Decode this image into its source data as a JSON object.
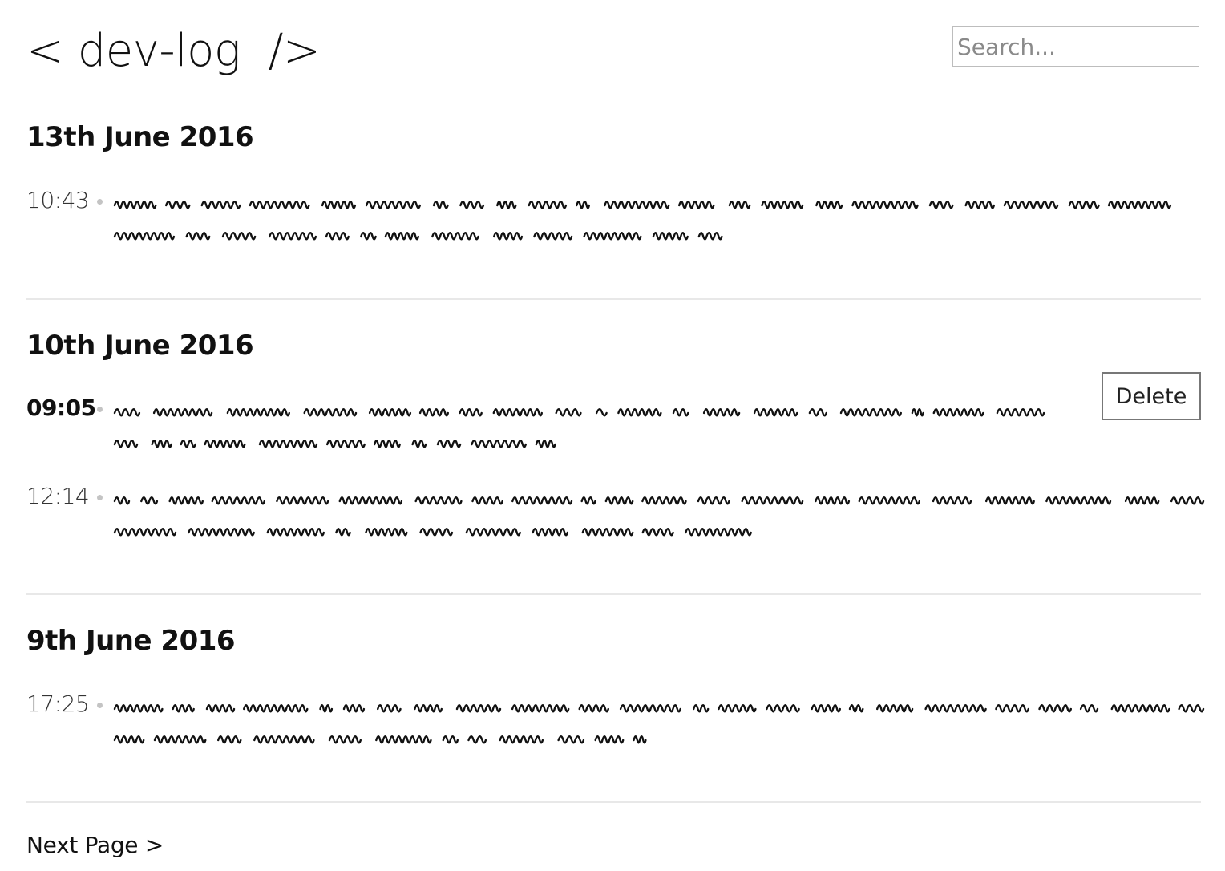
{
  "header": {
    "title": "< dev-log  />",
    "search_placeholder": "Search..."
  },
  "days": [
    {
      "date": "13th June 2016",
      "entries": [
        {
          "time": "10:43",
          "time_bold": false,
          "has_delete": false
        }
      ]
    },
    {
      "date": "10th June 2016",
      "entries": [
        {
          "time": "09:05",
          "time_bold": true,
          "has_delete": true,
          "delete_label": "Delete"
        },
        {
          "time": "12:14",
          "time_bold": false,
          "has_delete": false
        }
      ]
    },
    {
      "date": "9th June 2016",
      "entries": [
        {
          "time": "17:25",
          "time_bold": false,
          "has_delete": false
        }
      ]
    }
  ],
  "footer": {
    "next_label": "Next Page >"
  }
}
